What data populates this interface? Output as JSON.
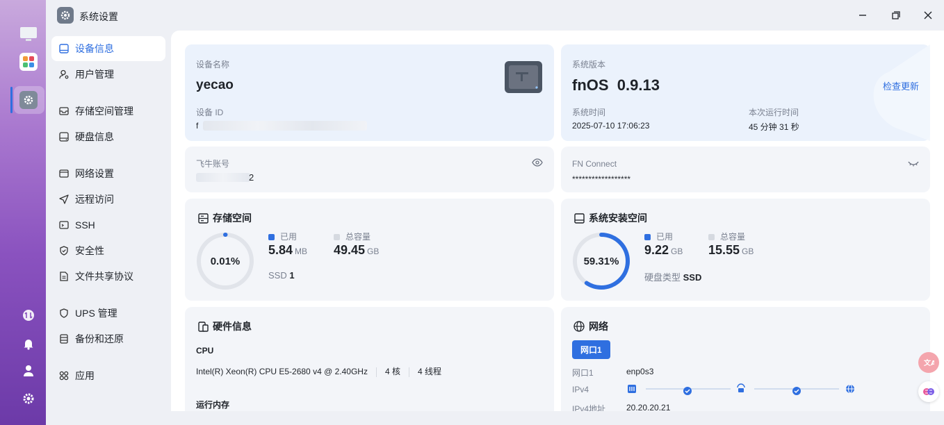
{
  "window": {
    "title": "系统设置",
    "controls": [
      "minimize",
      "maximize",
      "close"
    ]
  },
  "dock": {
    "items": [
      "monitor-icon",
      "apps-icon",
      "settings-icon",
      "transfer-icon",
      "bell-icon",
      "user-icon",
      "gear-icon"
    ]
  },
  "sidebar": {
    "items": [
      {
        "label": "设备信息",
        "icon": "device-icon",
        "active": true
      },
      {
        "label": "用户管理",
        "icon": "user-icon"
      },
      {
        "label": "存储空间管理",
        "icon": "storage-icon"
      },
      {
        "label": "硬盘信息",
        "icon": "disk-icon"
      },
      {
        "label": "网络设置",
        "icon": "network-icon"
      },
      {
        "label": "远程访问",
        "icon": "send-icon"
      },
      {
        "label": "SSH",
        "icon": "terminal-icon"
      },
      {
        "label": "安全性",
        "icon": "shield-icon"
      },
      {
        "label": "文件共享协议",
        "icon": "file-share-icon"
      },
      {
        "label": "UPS 管理",
        "icon": "ups-icon"
      },
      {
        "label": "备份和还原",
        "icon": "backup-icon"
      },
      {
        "label": "应用",
        "icon": "apps-icon"
      }
    ]
  },
  "device": {
    "name_label": "设备名称",
    "name": "yecao",
    "id_label": "设备 ID",
    "id_value": "f"
  },
  "system": {
    "version_label": "系统版本",
    "os_name": "fnOS",
    "version": "0.9.13",
    "check_update": "检查更新",
    "time_label": "系统时间",
    "time_value": "2025-07-10 17:06:23",
    "uptime_label": "本次运行时间",
    "uptime_value": "45 分钟 31 秒"
  },
  "account": {
    "label": "飞牛账号",
    "value": "2"
  },
  "connect": {
    "label": "FN Connect",
    "value": "******************"
  },
  "storage": {
    "title": "存储空间",
    "percent": "0.01%",
    "percent_value": 0.01,
    "used_label": "已用",
    "used_value": "5.84",
    "used_unit": "MB",
    "total_label": "总容量",
    "total_value": "49.45",
    "total_unit": "GB",
    "ssd_label": "SSD",
    "ssd_count": "1"
  },
  "system_storage": {
    "title": "系统安装空间",
    "percent": "59.31%",
    "percent_value": 59.31,
    "used_label": "已用",
    "used_value": "9.22",
    "used_unit": "GB",
    "total_label": "总容量",
    "total_value": "15.55",
    "total_unit": "GB",
    "disk_type_label": "硬盘类型",
    "disk_type_value": "SSD"
  },
  "hardware": {
    "title": "硬件信息",
    "cpu_label": "CPU",
    "cpu_model": "Intel(R) Xeon(R) CPU E5-2680 v4 @ 2.40GHz",
    "cores": "4 核",
    "threads": "4 线程",
    "memory_label": "运行内存"
  },
  "network": {
    "title": "网络",
    "tab": "网口1",
    "port_label": "网口1",
    "port_value": "enp0s3",
    "ipv4_label": "IPv4",
    "ipv4_addr_label": "IPv4地址",
    "ipv4_addr_value": "20.20.20.21"
  },
  "colors": {
    "accent": "#2f6fe0",
    "ring_track": "#e1e4ea"
  }
}
